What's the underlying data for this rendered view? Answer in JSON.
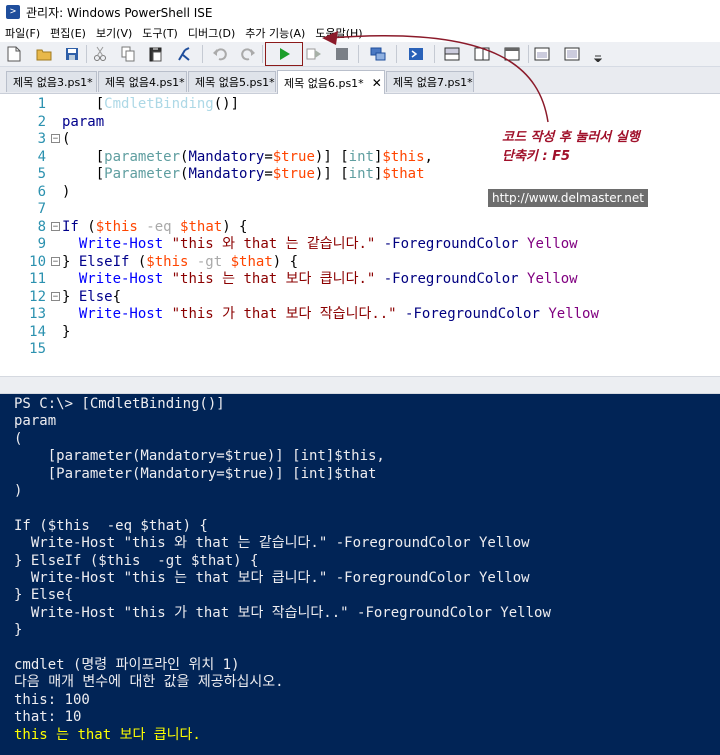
{
  "window": {
    "title": "관리자: Windows PowerShell ISE",
    "app_icon": "powershell-icon"
  },
  "menu": [
    "파일(F)",
    "편집(E)",
    "보기(V)",
    "도구(T)",
    "디버그(D)",
    "추가 기능(A)",
    "도움말(H)"
  ],
  "toolbar": {
    "icons": [
      "new-file-icon",
      "open-folder-icon",
      "save-icon",
      "cut-icon",
      "copy-icon",
      "paste-icon",
      "clear-icon",
      "undo-icon",
      "redo-icon",
      "run-script-icon",
      "run-selection-icon",
      "stop-icon",
      "remote-icon",
      "powershell-icon",
      "layout-top-icon",
      "layout-right-icon",
      "layout-max-icon",
      "dropdown-icon"
    ]
  },
  "tabs": [
    "제목 없음3.ps1*",
    "제목 없음4.ps1*",
    "제목 없음5.ps1*",
    "제목 없음6.ps1*",
    "제목 없음7.ps1*"
  ],
  "active_tab": 3,
  "editor": {
    "line_numbers": [
      "1",
      "2",
      "3",
      "4",
      "5",
      "6",
      "7",
      "8",
      "9",
      "10",
      "11",
      "12",
      "13",
      "14",
      "15"
    ],
    "lines": [
      [
        [
          "    ",
          "plain"
        ],
        [
          "[",
          "plain"
        ],
        [
          "CmdletBinding",
          "attr"
        ],
        [
          "()",
          "plain"
        ],
        [
          "]",
          "plain"
        ]
      ],
      [
        [
          "param",
          "kw"
        ]
      ],
      [
        [
          "(",
          "plain"
        ]
      ],
      [
        [
          "    ",
          "plain"
        ],
        [
          "[",
          "plain"
        ],
        [
          "parameter",
          "type"
        ],
        [
          "(",
          "plain"
        ],
        [
          "Mandatory",
          "param"
        ],
        [
          "=",
          "plain"
        ],
        [
          "$true",
          "var"
        ],
        [
          ")] ",
          "plain"
        ],
        [
          "[",
          "plain"
        ],
        [
          "int",
          "type"
        ],
        [
          "]",
          "plain"
        ],
        [
          "$this",
          "var"
        ],
        [
          ",",
          "plain"
        ]
      ],
      [
        [
          "    ",
          "plain"
        ],
        [
          "[",
          "plain"
        ],
        [
          "Parameter",
          "type"
        ],
        [
          "(",
          "plain"
        ],
        [
          "Mandatory",
          "param"
        ],
        [
          "=",
          "plain"
        ],
        [
          "$true",
          "var"
        ],
        [
          ")] ",
          "plain"
        ],
        [
          "[",
          "plain"
        ],
        [
          "int",
          "type"
        ],
        [
          "]",
          "plain"
        ],
        [
          "$that",
          "var"
        ]
      ],
      [
        [
          ")",
          "plain"
        ]
      ],
      [
        [
          "",
          "plain"
        ]
      ],
      [
        [
          "If",
          "kw"
        ],
        [
          " (",
          "plain"
        ],
        [
          "$this",
          "var"
        ],
        [
          " -eq ",
          "op"
        ],
        [
          "$that",
          "var"
        ],
        [
          ") {",
          "plain"
        ]
      ],
      [
        [
          "  ",
          "plain"
        ],
        [
          "Write-Host",
          "cmd"
        ],
        [
          " ",
          "plain"
        ],
        [
          "\"this 와 that 는 같습니다.\"",
          "str"
        ],
        [
          " -ForegroundColor ",
          "param"
        ],
        [
          "Yellow",
          "num"
        ]
      ],
      [
        [
          "} ",
          "plain"
        ],
        [
          "ElseIf",
          "kw"
        ],
        [
          " (",
          "plain"
        ],
        [
          "$this",
          "var"
        ],
        [
          " -gt ",
          "op"
        ],
        [
          "$that",
          "var"
        ],
        [
          ") {",
          "plain"
        ]
      ],
      [
        [
          "  ",
          "plain"
        ],
        [
          "Write-Host",
          "cmd"
        ],
        [
          " ",
          "plain"
        ],
        [
          "\"this 는 that 보다 큽니다.\"",
          "str"
        ],
        [
          " -ForegroundColor ",
          "param"
        ],
        [
          "Yellow",
          "num"
        ]
      ],
      [
        [
          "} ",
          "plain"
        ],
        [
          "Else",
          "kw"
        ],
        [
          "{",
          "plain"
        ]
      ],
      [
        [
          "  ",
          "plain"
        ],
        [
          "Write-Host",
          "cmd"
        ],
        [
          " ",
          "plain"
        ],
        [
          "\"this 가 that 보다 작습니다..\"",
          "str"
        ],
        [
          " -ForegroundColor ",
          "param"
        ],
        [
          "Yellow",
          "num"
        ]
      ],
      [
        [
          "}",
          "plain"
        ]
      ],
      [
        [
          "",
          "plain"
        ]
      ]
    ],
    "fold_lines": [
      2,
      7,
      9,
      11
    ]
  },
  "annotation": {
    "line1": "코드 작성 후 눌러서 실행",
    "line2": "단축키 : F5",
    "watermark": "http://www.delmaster.net",
    "color": "#a0102a"
  },
  "console": {
    "lines": [
      "PS C:\\> [CmdletBinding()]",
      "param",
      "(",
      "    [parameter(Mandatory=$true)] [int]$this,",
      "    [Parameter(Mandatory=$true)] [int]$that",
      ")",
      "",
      "If ($this  -eq $that) {",
      "  Write-Host \"this 와 that 는 같습니다.\" -ForegroundColor Yellow",
      "} ElseIf ($this  -gt $that) {",
      "  Write-Host \"this 는 that 보다 큽니다.\" -ForegroundColor Yellow",
      "} Else{",
      "  Write-Host \"this 가 that 보다 작습니다..\" -ForegroundColor Yellow",
      "}",
      "",
      "cmdlet (명령 파이프라인 위치 1)",
      "다음 매개 변수에 대한 값을 제공하십시오.",
      "this: 100",
      "that: 10",
      "this 는 that 보다 큽니다."
    ],
    "highlight_last": true,
    "background": "#012456",
    "highlight_color": "#ffff00"
  }
}
